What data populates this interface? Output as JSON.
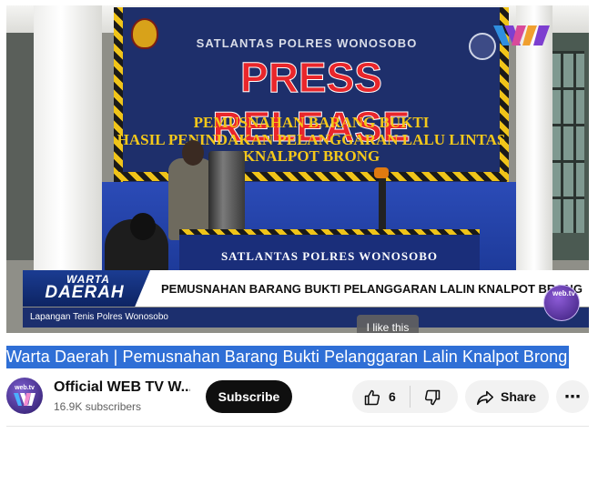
{
  "video": {
    "banner_org": "SATLANTAS POLRES WONOSOBO",
    "banner_title": "PRESS RELEASE",
    "banner_line1": "PEMUSNAHAN BARANG BUKTI",
    "banner_line2": "HASIL PENINDAKAN PELANGGARAN LALU LINTAS",
    "banner_line3": "KNALPOT BRONG",
    "table_text": "SATLANTAS POLRES WONOSOBO",
    "lower_third_brand_top": "WARTA",
    "lower_third_brand_bottom": "DAERAH",
    "lower_third_headline": "PEMUSNAHAN BARANG BUKTI PELANGGARAN LALIN KNALPOT BRONG",
    "lower_third_location": "Lapangan Tenis Polres Wonosobo",
    "watermark_text": "web.tv",
    "tooltip": "I like this"
  },
  "title": "Warta Daerah | Pemusnahan Barang Bukti Pelanggaran Lalin Knalpot Brong",
  "channel": {
    "name": "Official WEB TV W...",
    "subscribers": "16.9K subscribers",
    "avatar_text": "web.tv",
    "subscribe_label": "Subscribe"
  },
  "actions": {
    "like_count": "6",
    "share_label": "Share",
    "more_label": "⋯",
    "like_icon": "thumbs-up-icon",
    "dislike_icon": "thumbs-down-icon",
    "share_icon": "share-arrow-icon",
    "more_icon": "more-horizontal-icon"
  },
  "colors": {
    "title_highlight": "#2f6fd6",
    "subscribe_bg": "#0f0f0f",
    "pill_bg": "#f2f2f2"
  }
}
